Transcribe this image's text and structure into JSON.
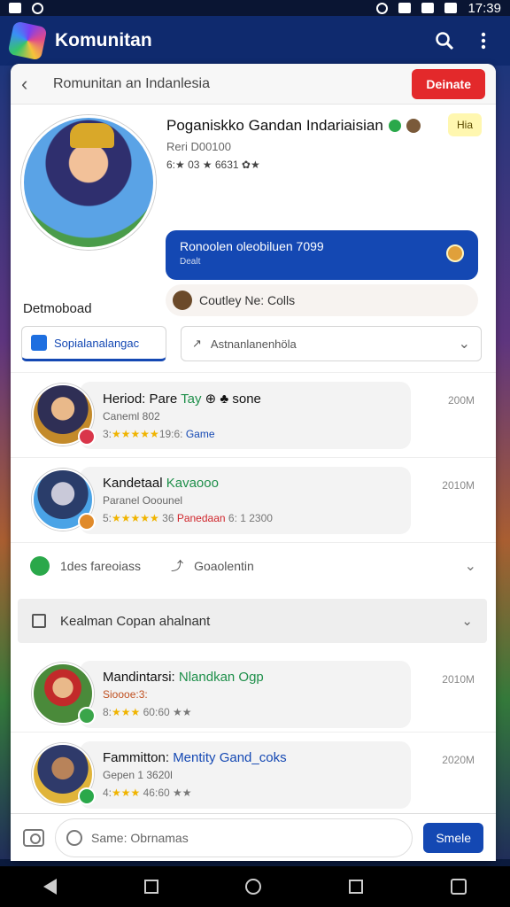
{
  "status_bar": {
    "time": "17:39"
  },
  "app_bar": {
    "title": "Komunitan"
  },
  "card_header": {
    "title": "Romunitan an Indanlesia",
    "button_label": "Deinate"
  },
  "profile": {
    "name": "Poganiskko Gandan Indariaisian",
    "id_text": "Reri D00100",
    "stats_text": "6:★ 03 ★ 6631 ✿★",
    "badge": "Hia",
    "blue_pill_line1": "Ronoolen oleobiluen 7099",
    "blue_pill_line2": "Dealt",
    "courtesy_text": "Coutley Ne: Colls"
  },
  "section": {
    "title": "Detmoboad",
    "active_tab": "Sopialanalangac",
    "dropdown_value": "Astnanlanenhöla"
  },
  "items": [
    {
      "title_main": "Heriod: Pare ",
      "title_accent": "Tay",
      "title_extra": " ⊕ ♣ sone",
      "sub": "Caneml 802",
      "meta_prefix": "3:",
      "stars": "★★★★★",
      "meta_mid": "19:6: ",
      "meta_tag": "Game",
      "time": "200M"
    },
    {
      "title_main": "Kandetaal ",
      "title_accent": "Kavaooo",
      "title_extra": "",
      "sub": "Paranel Ooounel",
      "meta_prefix": "5:",
      "stars": "★★★★★",
      "meta_mid": " 36 ",
      "meta_tag": "Panedaan",
      "meta_suffix": " 6: 1 2300",
      "time": "2010M"
    },
    {
      "title_main": "Mandintarsi: ",
      "title_accent": "Nlandkan Ogp",
      "title_extra": "",
      "sub": "Sioooe:3:",
      "meta_prefix": "8:",
      "stars": "★★★",
      "meta_mid": " 60:60 ★★",
      "meta_tag": "",
      "time": "2010M"
    },
    {
      "title_main": "Fammitton: ",
      "title_accent": "Mentity Gand_coks",
      "title_extra": "",
      "sub": "Gepen 1 3620l",
      "meta_prefix": "4:",
      "stars": "★★★",
      "meta_mid": " 46:60 ★★",
      "meta_tag": "",
      "time": "2020M"
    }
  ],
  "footer_row": {
    "left_label": "1des fareoiass",
    "right_label": "Goaolentin"
  },
  "group_header": {
    "title": "Kealman Copan  ahalnant"
  },
  "compose": {
    "placeholder": "Same: Obrnamas",
    "send_label": "Smele"
  }
}
